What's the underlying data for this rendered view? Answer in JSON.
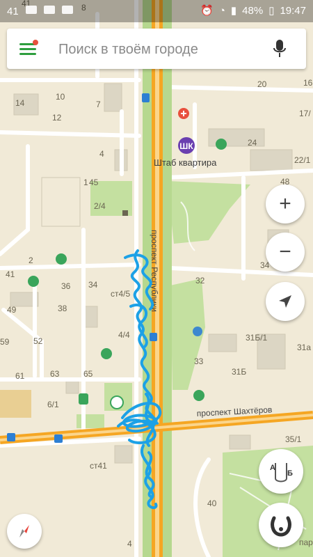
{
  "status_bar": {
    "left_number": "41",
    "battery": "48%",
    "time": "19:47"
  },
  "search": {
    "placeholder": "Поиск в твоём городе"
  },
  "map": {
    "streets": {
      "vertical": "проспект Республики",
      "horizontal": "проспект Шахтёров"
    },
    "poi": {
      "headquarters_badge": "ШК",
      "headquarters_label": "Штаб квартира"
    },
    "house_numbers": {
      "h41_top": "41",
      "h8": "8",
      "h10": "10",
      "h7": "7",
      "h14": "14",
      "h12": "12",
      "h20": "20",
      "h16": "16",
      "h17_1": "17/",
      "h24": "24",
      "h22_1": "22/1",
      "h4": "4",
      "h45": "45",
      "h1": "1",
      "h2_4": "2/4",
      "h48": "48",
      "h2": "2",
      "h41": "41",
      "h36": "36",
      "h34": "34",
      "h34b": "34",
      "h38": "38",
      "h49": "49",
      "hst45": "ст4/5",
      "h32": "32",
      "h36r": "36",
      "h4_4": "4/4",
      "h52": "52",
      "h59": "59",
      "h31b1": "31Б/1",
      "h31a": "31а",
      "h33": "33",
      "h31b": "31Б",
      "h61": "61",
      "h63": "63",
      "h65": "65",
      "h6_1": "6/1",
      "h35_1": "35/1",
      "hst41": "ст41",
      "h40": "40",
      "h4bottom": "4",
      "hpar": "пар"
    }
  },
  "controls": {
    "zoom_in": "+",
    "zoom_out": "−",
    "route_from": "А",
    "route_to": "Б"
  }
}
